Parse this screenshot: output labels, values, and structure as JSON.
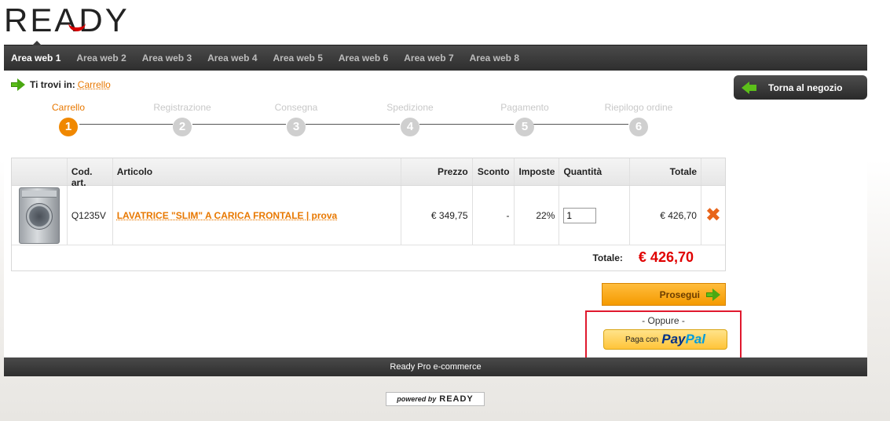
{
  "brand": {
    "logo": "READY"
  },
  "nav": {
    "items": [
      {
        "label": "Area web 1",
        "active": true
      },
      {
        "label": "Area web 2"
      },
      {
        "label": "Area web 3"
      },
      {
        "label": "Area web 4"
      },
      {
        "label": "Area web 5"
      },
      {
        "label": "Area web 6"
      },
      {
        "label": "Area web 7"
      },
      {
        "label": "Area web 8"
      }
    ]
  },
  "breadcrumb": {
    "label": "Ti trovi in:",
    "current": "Carrello"
  },
  "back_button": {
    "label": "Torna al negozio"
  },
  "steps": [
    {
      "label": "Carrello",
      "number": "1",
      "active": true
    },
    {
      "label": "Registrazione",
      "number": "2"
    },
    {
      "label": "Consegna",
      "number": "3"
    },
    {
      "label": "Spedizione",
      "number": "4"
    },
    {
      "label": "Pagamento",
      "number": "5"
    },
    {
      "label": "Riepilogo ordine",
      "number": "6"
    }
  ],
  "cart": {
    "headers": {
      "code": "Cod. art.",
      "article": "Articolo",
      "price": "Prezzo",
      "discount": "Sconto",
      "tax": "Imposte",
      "quantity": "Quantità",
      "total": "Totale"
    },
    "items": [
      {
        "code": "Q1235V",
        "article": "LAVATRICE \"SLIM\" A CARICA FRONTALE | prova",
        "price": "€ 349,75",
        "discount": "-",
        "tax": "22%",
        "quantity": "1",
        "total": "€ 426,70"
      }
    ],
    "total_label": "Totale:",
    "total_value": "€ 426,70"
  },
  "proceed_button": {
    "label": "Prosegui"
  },
  "paypal": {
    "oppure": "- Oppure -",
    "prefix": "Paga con",
    "pay": "Pay",
    "pal": "Pal"
  },
  "footer": {
    "text": "Ready Pro e-commerce"
  },
  "powered": {
    "prefix": "powered by",
    "logo": "READY"
  },
  "colors": {
    "accent": "#e87800",
    "total_red": "#e00000",
    "highlight_border": "#e0192e",
    "nav_bg": "#333333"
  }
}
